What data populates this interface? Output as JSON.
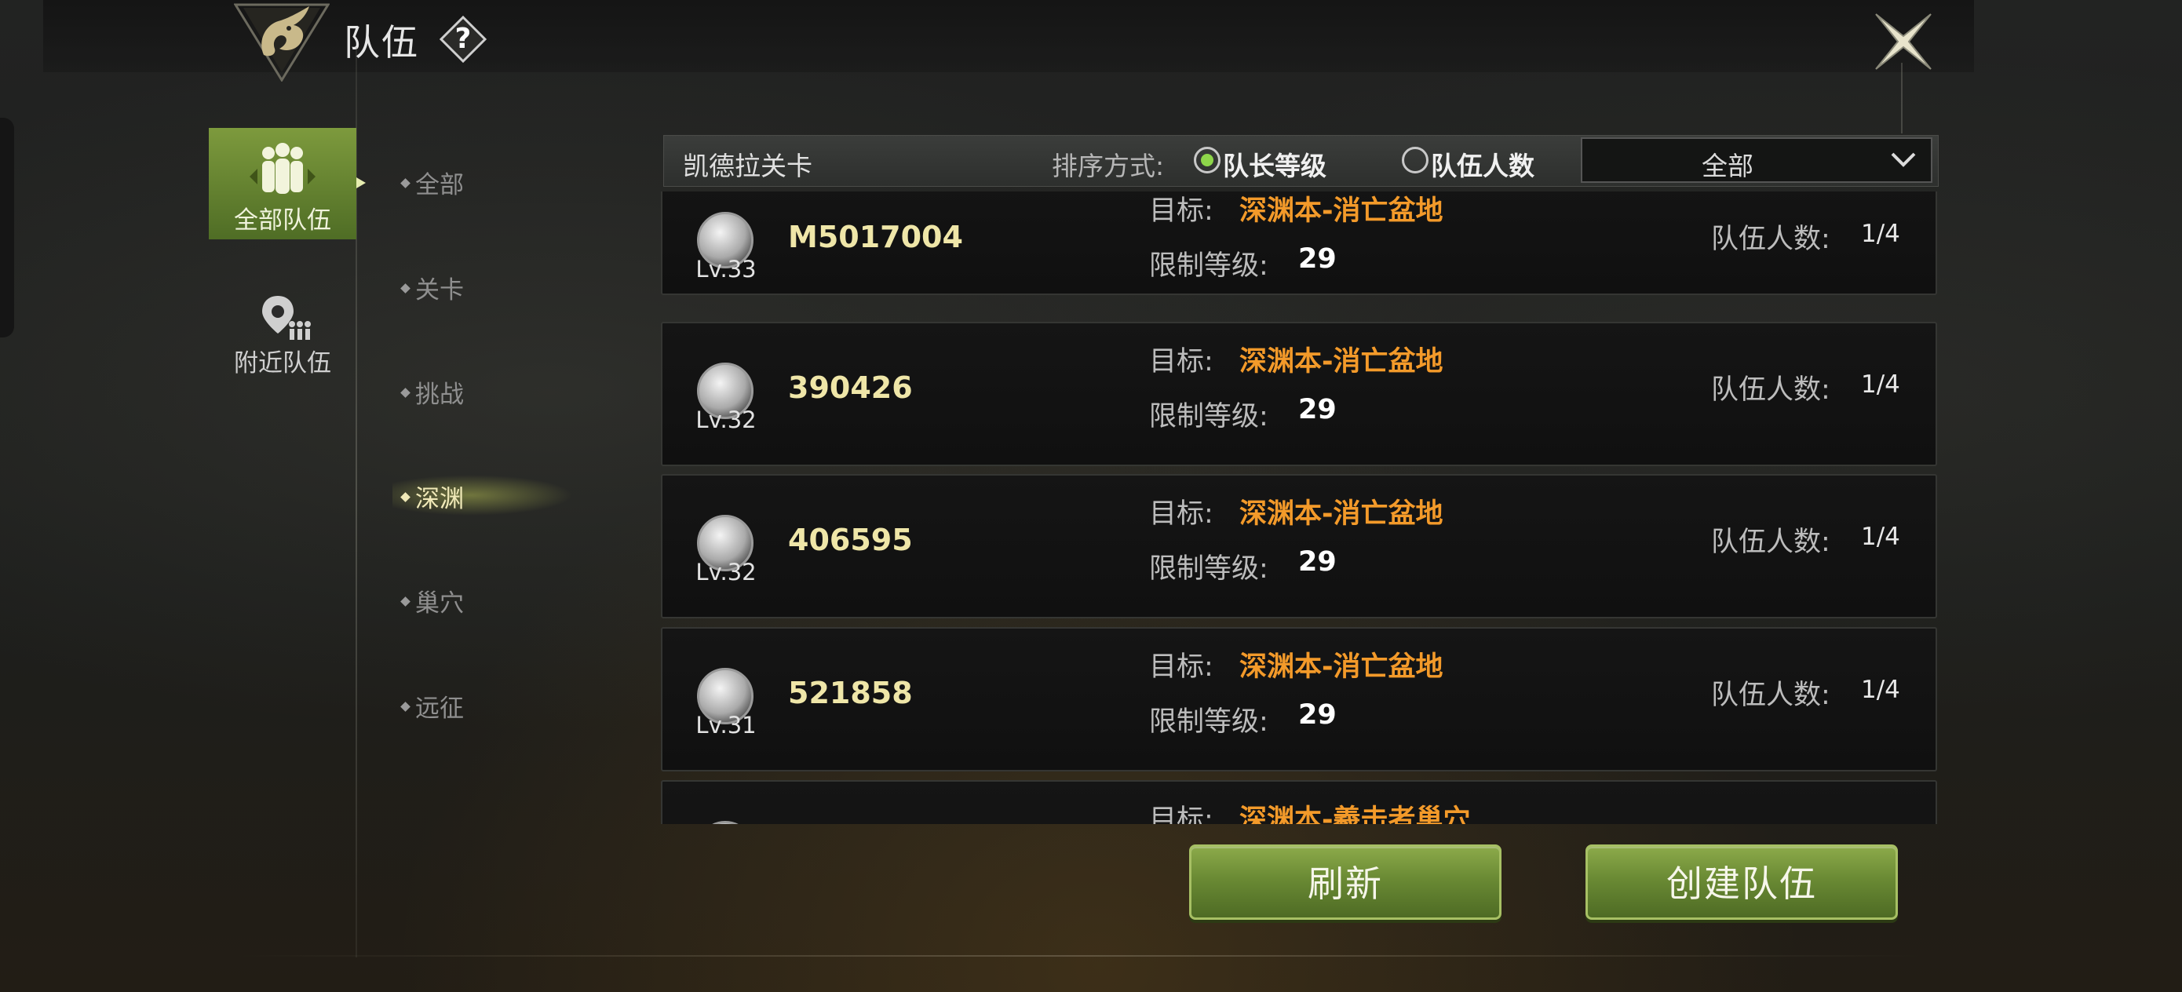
{
  "header": {
    "title": "队伍",
    "help": "?"
  },
  "sidebar": {
    "tabs": [
      {
        "label": "全部队伍"
      },
      {
        "label": "附近队伍"
      }
    ]
  },
  "categories": [
    "全部",
    "关卡",
    "挑战",
    "深渊",
    "巢穴",
    "远征"
  ],
  "active_category": "深渊",
  "filter": {
    "title": "凯德拉关卡",
    "sort_label": "排序方式:",
    "options": [
      "队长等级",
      "队伍人数"
    ],
    "selected_option": "队长等级",
    "dropdown_value": "全部"
  },
  "labels": {
    "target": "目标:",
    "level_limit": "限制等级:",
    "team_count": "队伍人数:"
  },
  "teams": [
    {
      "level": "Lv.33",
      "id": "M5017004",
      "target": "深渊本-消亡盆地",
      "limit": "29",
      "count": "1/4"
    },
    {
      "level": "Lv.32",
      "id": "390426",
      "target": "深渊本-消亡盆地",
      "limit": "29",
      "count": "1/4"
    },
    {
      "level": "Lv.32",
      "id": "406595",
      "target": "深渊本-消亡盆地",
      "limit": "29",
      "count": "1/4"
    },
    {
      "level": "Lv.31",
      "id": "521858",
      "target": "深渊本-消亡盆地",
      "limit": "29",
      "count": "1/4"
    },
    {
      "target": "深渊本-羲击者巢穴"
    }
  ],
  "buttons": {
    "refresh": "刷新",
    "create": "创建队伍"
  },
  "colors": {
    "accent_green": "#7d9a3d",
    "target_orange": "#f39a2a",
    "id_yellow": "#efe6a8"
  }
}
